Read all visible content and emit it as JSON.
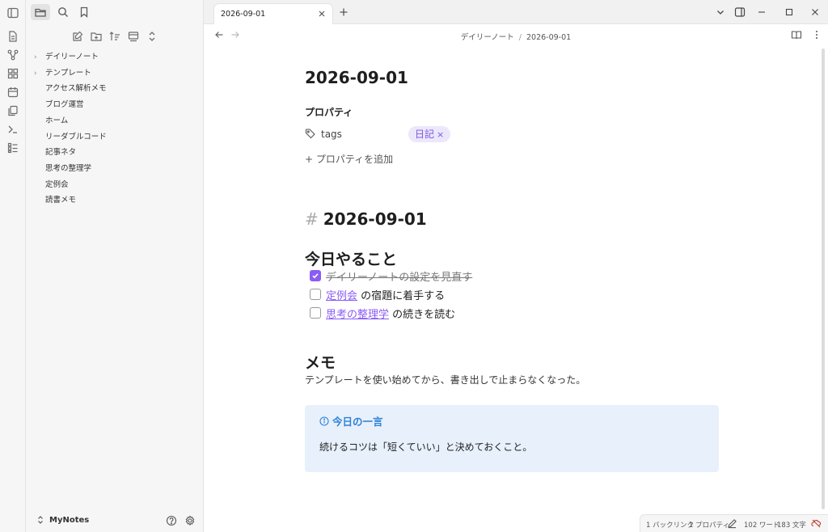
{
  "sidebar": {
    "tree": [
      {
        "label": "デイリーノート",
        "folder": true
      },
      {
        "label": "テンプレート",
        "folder": true
      },
      {
        "label": "アクセス解析メモ",
        "folder": false
      },
      {
        "label": "ブログ運営",
        "folder": false
      },
      {
        "label": "ホーム",
        "folder": false
      },
      {
        "label": "リーダブルコード",
        "folder": false
      },
      {
        "label": "記事ネタ",
        "folder": false
      },
      {
        "label": "思考の整理学",
        "folder": false
      },
      {
        "label": "定例会",
        "folder": false
      },
      {
        "label": "読書メモ",
        "folder": false
      }
    ],
    "vault_name": "MyNotes"
  },
  "tab": {
    "title": "2026-09-01"
  },
  "breadcrumb": {
    "folder": "デイリーノート",
    "separator": "/",
    "file": "2026-09-01"
  },
  "note": {
    "title": "2026-09-01",
    "properties_heading": "プロパティ",
    "property_name": "tags",
    "property_value": "日記",
    "property_remove": "×",
    "add_property": "+ プロパティを追加",
    "heading1_hash": "#",
    "heading1": "2026-09-01",
    "heading_todo": "今日やること",
    "tasks": [
      {
        "checked": true,
        "link": "",
        "text": "デイリーノートの設定を見直す"
      },
      {
        "checked": false,
        "link": "定例会",
        "text": " の宿題に着手する"
      },
      {
        "checked": false,
        "link": "思考の整理学",
        "text": " の続きを読む"
      }
    ],
    "heading_memo": "メモ",
    "memo_text": "テンプレートを使い始めてから、書き出しで止まらなくなった。",
    "callout_title": "今日の一言",
    "callout_body": "続けるコツは「短くていい」と決めておくこと。"
  },
  "status": {
    "backlinks": "1 バックリンク",
    "properties": "1 プロパティ",
    "words": "102 ワード",
    "chars": "183 文字"
  },
  "colors": {
    "accent": "#8a5cf5",
    "callout_bg": "#e7f0fb",
    "callout_title": "#2e82d8"
  }
}
